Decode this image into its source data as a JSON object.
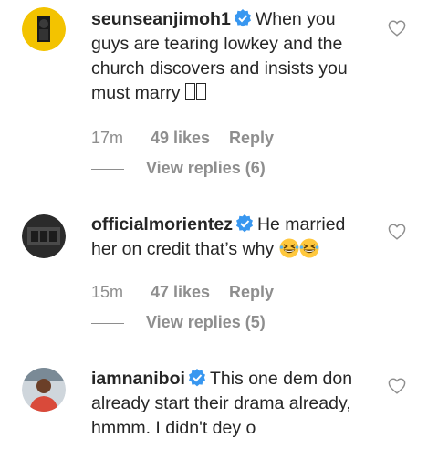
{
  "comments": [
    {
      "username": "seunseanjimoh1",
      "text": "When you guys are tearing lowkey and the church discovers and insists you must marry",
      "text_suffix_glyphs": "▯▯",
      "time": "17m",
      "likes": "49 likes",
      "reply": "Reply",
      "view_replies": "View replies (6)",
      "avatar_color": "#f3c300"
    },
    {
      "username": "officialmorientez",
      "text": "He married her on credit that’s why",
      "emoji": [
        "grinning-squinting-face",
        "grinning-squinting-face"
      ],
      "time": "15m",
      "likes": "47 likes",
      "reply": "Reply",
      "view_replies": "View replies (5)",
      "avatar_color": "#2b2b2b"
    },
    {
      "username": "iamnaniboi",
      "text": "This one dem don already start their drama already, hmmm. I didn't dey o",
      "avatar_color": "#d94a3a"
    }
  ],
  "colors": {
    "verified": "#3897f0",
    "secondary_text": "#8e8e8e",
    "primary_text": "#262626"
  }
}
